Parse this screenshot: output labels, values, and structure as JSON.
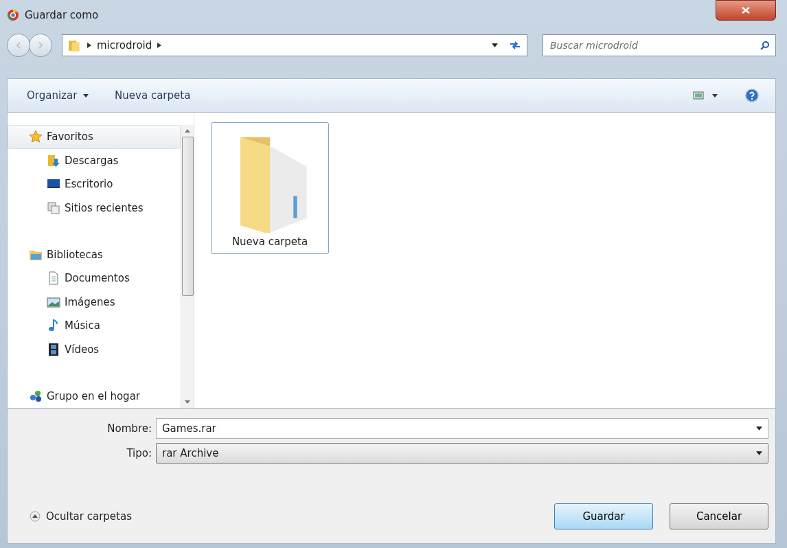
{
  "window": {
    "title": "Guardar como"
  },
  "address": {
    "path": [
      "microdroid"
    ],
    "search_placeholder": "Buscar microdroid"
  },
  "toolbar": {
    "organize": "Organizar",
    "new_folder": "Nueva carpeta"
  },
  "sidebar": {
    "groups": [
      {
        "label": "Favoritos",
        "selected": true,
        "children": [
          {
            "label": "Descargas",
            "selected": false
          },
          {
            "label": "Escritorio",
            "selected": false
          },
          {
            "label": "Sitios recientes",
            "selected": false
          }
        ]
      },
      {
        "label": "Bibliotecas",
        "selected": false,
        "children": [
          {
            "label": "Documentos",
            "selected": false
          },
          {
            "label": "Imágenes",
            "selected": false
          },
          {
            "label": "Música",
            "selected": false
          },
          {
            "label": "Vídeos",
            "selected": false
          }
        ]
      },
      {
        "label": "Grupo en el hogar",
        "selected": false
      }
    ]
  },
  "files": [
    {
      "name": "Nueva carpeta",
      "selected": true
    }
  ],
  "form": {
    "name_label": "Nombre:",
    "name_value": "Games.rar",
    "type_label": "Tipo:",
    "type_value": "rar Archive"
  },
  "footer": {
    "toggle": "Ocultar carpetas",
    "save": "Guardar",
    "cancel": "Cancelar"
  }
}
